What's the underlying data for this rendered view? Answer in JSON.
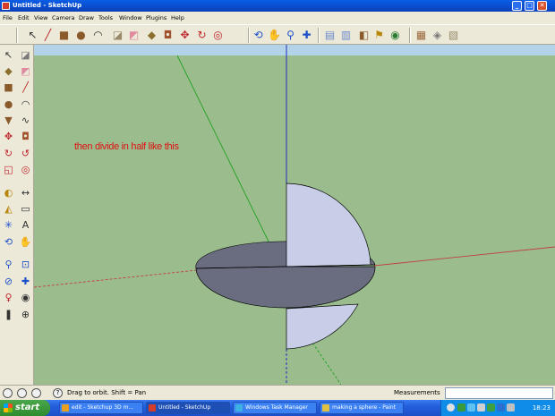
{
  "window": {
    "title": "Untitled - SketchUp",
    "minimize": "_",
    "maximize": "□",
    "close": "✕"
  },
  "menu": {
    "items": [
      "File",
      "Edit",
      "View",
      "Camera",
      "Draw",
      "Tools",
      "Window",
      "Plugins",
      "Help"
    ]
  },
  "toolbar": {
    "buttons": [
      {
        "name": "select-tool-icon",
        "glyph": "↖",
        "color": "#333333"
      },
      {
        "name": "line-tool-icon",
        "glyph": "╱",
        "color": "#b22222"
      },
      {
        "name": "rectangle-tool-icon",
        "glyph": "■",
        "color": "#8b5a2b"
      },
      {
        "name": "circle-tool-icon",
        "glyph": "●",
        "color": "#8b5a2b"
      },
      {
        "name": "arc-tool-icon",
        "glyph": "◠",
        "color": "#333333"
      },
      {
        "name": "make-component-icon",
        "glyph": "◪",
        "color": "#9a8a6a"
      },
      {
        "name": "eraser-tool-icon",
        "glyph": "◩",
        "color": "#e08aa0"
      },
      {
        "name": "paint-bucket-icon",
        "glyph": "◆",
        "color": "#8b6f2f"
      },
      {
        "name": "push-pull-icon",
        "glyph": "◘",
        "color": "#a0522d"
      },
      {
        "name": "move-tool-icon",
        "glyph": "✥",
        "color": "#c0282d"
      },
      {
        "name": "rotate-tool-icon",
        "glyph": "↻",
        "color": "#c0282d"
      },
      {
        "name": "offset-tool-icon",
        "glyph": "◎",
        "color": "#c0282d"
      },
      {
        "name": "orbit-tool-icon",
        "glyph": "⟲",
        "color": "#1e50c8"
      },
      {
        "name": "pan-tool-icon",
        "glyph": "✋",
        "color": "#333333"
      },
      {
        "name": "zoom-tool-icon",
        "glyph": "⚲",
        "color": "#1e50c8"
      },
      {
        "name": "zoom-extents-icon",
        "glyph": "✚",
        "color": "#1e50c8"
      },
      {
        "name": "get-models-icon",
        "glyph": "▤",
        "color": "#6a8acd"
      },
      {
        "name": "share-model-icon",
        "glyph": "▥",
        "color": "#6a8acd"
      },
      {
        "name": "place-model-icon",
        "glyph": "◧",
        "color": "#8b5a2b"
      },
      {
        "name": "add-location-icon",
        "glyph": "⚑",
        "color": "#b8860b"
      },
      {
        "name": "toggle-terrain-icon",
        "glyph": "◉",
        "color": "#2e7d32"
      },
      {
        "name": "photo-textures-icon",
        "glyph": "▦",
        "color": "#9a6a3a"
      },
      {
        "name": "preview-in-google-earth-icon",
        "glyph": "◈",
        "color": "#7a7a7a"
      },
      {
        "name": "get-current-view-icon",
        "glyph": "▧",
        "color": "#9a8a6a"
      }
    ]
  },
  "left_toolbar": {
    "buttons": [
      {
        "name": "select-tool-icon",
        "glyph": "↖",
        "color": "#333333"
      },
      {
        "name": "make-component-icon",
        "glyph": "◪",
        "color": "#7a7a7a"
      },
      {
        "name": "paint-bucket-icon",
        "glyph": "◆",
        "color": "#8b6f2f"
      },
      {
        "name": "eraser-tool-icon",
        "glyph": "◩",
        "color": "#e08aa0"
      },
      {
        "name": "rectangle-tool-icon",
        "glyph": "■",
        "color": "#8b5a2b"
      },
      {
        "name": "line-tool-icon",
        "glyph": "╱",
        "color": "#b22222"
      },
      {
        "name": "circle-tool-icon",
        "glyph": "●",
        "color": "#8b5a2b"
      },
      {
        "name": "arc-tool-icon",
        "glyph": "◠",
        "color": "#333333"
      },
      {
        "name": "polygon-tool-icon",
        "glyph": "▼",
        "color": "#8b5a2b"
      },
      {
        "name": "freehand-tool-icon",
        "glyph": "∿",
        "color": "#333333"
      },
      {
        "name": "move-tool-icon",
        "glyph": "✥",
        "color": "#c0282d"
      },
      {
        "name": "push-pull-icon",
        "glyph": "◘",
        "color": "#a0522d"
      },
      {
        "name": "rotate-tool-icon",
        "glyph": "↻",
        "color": "#c0282d"
      },
      {
        "name": "follow-me-icon",
        "glyph": "↺",
        "color": "#c0282d"
      },
      {
        "name": "scale-tool-icon",
        "glyph": "◱",
        "color": "#c0282d"
      },
      {
        "name": "offset-tool-icon",
        "glyph": "◎",
        "color": "#c0282d"
      },
      {
        "name": "tape-measure-icon",
        "glyph": "◐",
        "color": "#b8860b"
      },
      {
        "name": "dimension-tool-icon",
        "glyph": "↔",
        "color": "#333333"
      },
      {
        "name": "protractor-icon",
        "glyph": "◭",
        "color": "#b8860b"
      },
      {
        "name": "text-tool-icon",
        "glyph": "▭",
        "color": "#333333"
      },
      {
        "name": "axes-tool-icon",
        "glyph": "✳",
        "color": "#1e50c8"
      },
      {
        "name": "3d-text-icon",
        "glyph": "A",
        "color": "#333333"
      },
      {
        "name": "orbit-tool-icon",
        "glyph": "⟲",
        "color": "#1e50c8"
      },
      {
        "name": "pan-tool-icon",
        "glyph": "✋",
        "color": "#333333"
      },
      {
        "name": "zoom-tool-icon",
        "glyph": "⚲",
        "color": "#1e50c8"
      },
      {
        "name": "zoom-window-icon",
        "glyph": "⊡",
        "color": "#1e50c8"
      },
      {
        "name": "previous-view-icon",
        "glyph": "⊘",
        "color": "#1e50c8"
      },
      {
        "name": "zoom-extents-icon",
        "glyph": "✚",
        "color": "#1e50c8"
      },
      {
        "name": "position-camera-icon",
        "glyph": "♀",
        "color": "#c0282d"
      },
      {
        "name": "look-around-icon",
        "glyph": "◉",
        "color": "#333333"
      },
      {
        "name": "walk-tool-icon",
        "glyph": "❚",
        "color": "#333333"
      },
      {
        "name": "section-plane-icon",
        "glyph": "⊕",
        "color": "#333333"
      }
    ]
  },
  "viewport": {
    "annotation": "then divide in half like this",
    "colors": {
      "background": "#9bbd8e",
      "sky": "#b3d3e8",
      "face_front": "#c8cde8",
      "face_back": "#6a6d80",
      "red_axis": "#c04040",
      "green_axis": "#20a020",
      "blue_axis": "#2030c0"
    }
  },
  "status": {
    "hint": "Drag to orbit.  Shift = Pan",
    "measurements_label": "Measurements",
    "measurements_value": ""
  },
  "taskbar": {
    "start": "start",
    "tasks": [
      {
        "label": "edit - Sketchup 3D m...",
        "color": "#e8a020",
        "active": false
      },
      {
        "label": "Untitled - SketchUp",
        "color": "#d43c2c",
        "active": true
      },
      {
        "label": "Windows Task Manager",
        "color": "#3cb0e0",
        "active": false
      },
      {
        "label": "making a sphere - Paint",
        "color": "#e0c040",
        "active": false
      }
    ],
    "clock": "18:23"
  }
}
